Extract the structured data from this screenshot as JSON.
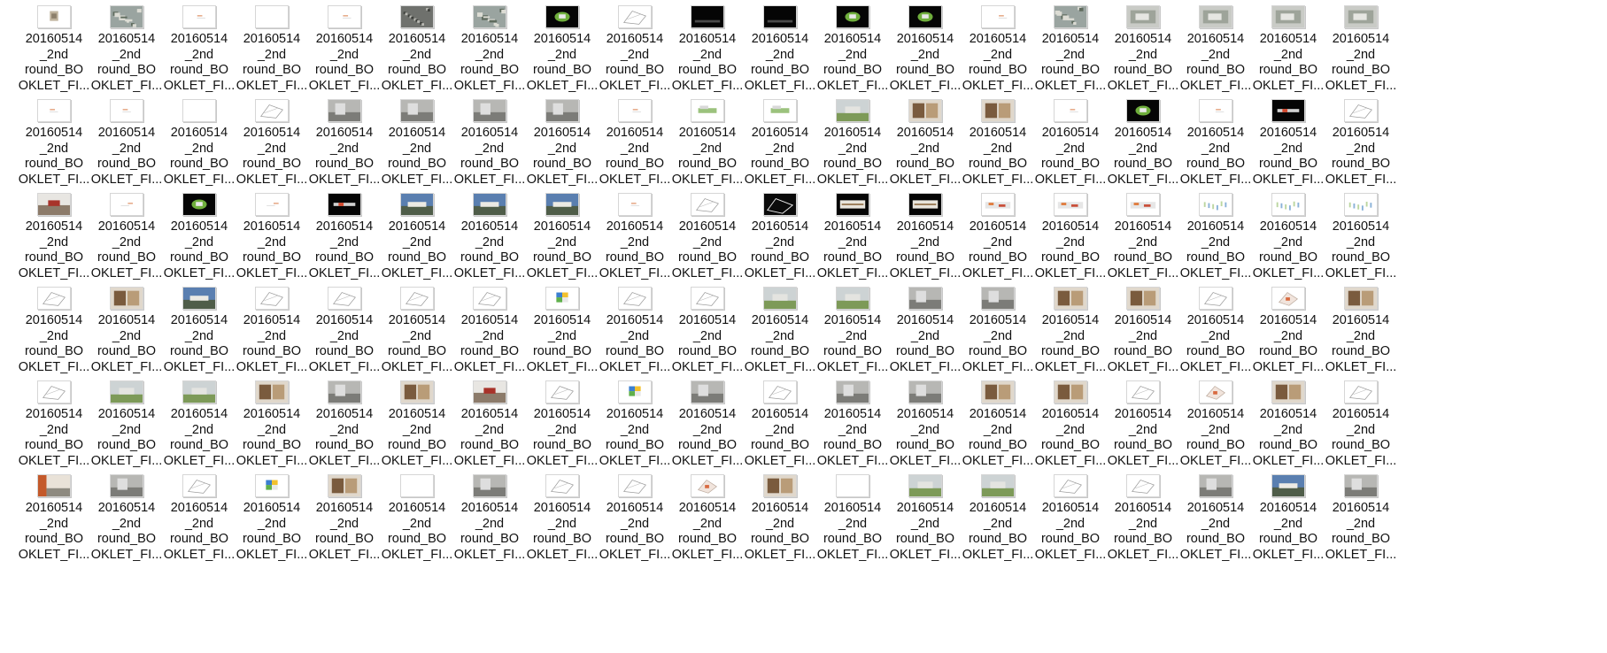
{
  "explorer": {
    "view": "large-icons",
    "file_name_lines": [
      "20160514",
      "_2nd",
      "round_BO",
      "OKLET_FI..."
    ],
    "thumbnail_kinds": [
      [
        "white-photo",
        "aerial",
        "white-text",
        "white-blank",
        "white-text",
        "aerial-dark",
        "aerial",
        "black-green",
        "drawing",
        "black",
        "black",
        "black-green",
        "black-green",
        "white-text",
        "aerial",
        "photo",
        "photo",
        "photo",
        "photo"
      ],
      [
        "white-text",
        "white-text",
        "white-blank",
        "drawing",
        "photo-grey",
        "photo-grey",
        "photo-grey",
        "photo-grey",
        "white-text",
        "drawing-green",
        "drawing-green",
        "photo-green",
        "photo-brown",
        "photo-brown",
        "white-text",
        "black-green",
        "white-text",
        "black-red",
        "drawing"
      ],
      [
        "photo-red",
        "white-text",
        "black-green",
        "white-text",
        "black-red",
        "photo-sky",
        "photo-sky",
        "photo-sky",
        "white-text",
        "drawing",
        "black-drawing",
        "black-section",
        "black-section",
        "section-color",
        "section-color",
        "section-color",
        "diagram",
        "diagram",
        "diagram"
      ],
      [
        "drawing",
        "photo-brown",
        "photo-sky",
        "drawing",
        "drawing",
        "drawing",
        "drawing",
        "diagram-color",
        "drawing",
        "drawing",
        "photo-green",
        "photo-green",
        "photo-grey",
        "photo-grey",
        "photo-brown",
        "photo-brown",
        "drawing",
        "drawing-red",
        "photo-brown"
      ],
      [
        "drawing",
        "photo-green",
        "photo-green",
        "photo-brown",
        "photo-grey",
        "photo-brown",
        "photo-red",
        "drawing",
        "diagram-color",
        "photo-grey",
        "drawing",
        "photo-grey",
        "photo-grey",
        "photo-brown",
        "photo-brown",
        "drawing",
        "drawing-red",
        "photo-brown",
        "drawing"
      ],
      [
        "photo-orange",
        "photo-grey",
        "drawing",
        "diagram-color",
        "photo-brown",
        "white-blank",
        "photo-grey",
        "drawing",
        "drawing",
        "drawing-red",
        "photo-brown",
        "white-blank",
        "photo-green",
        "photo-green",
        "drawing",
        "drawing",
        "photo-grey",
        "photo-sky",
        "photo-grey"
      ]
    ]
  }
}
